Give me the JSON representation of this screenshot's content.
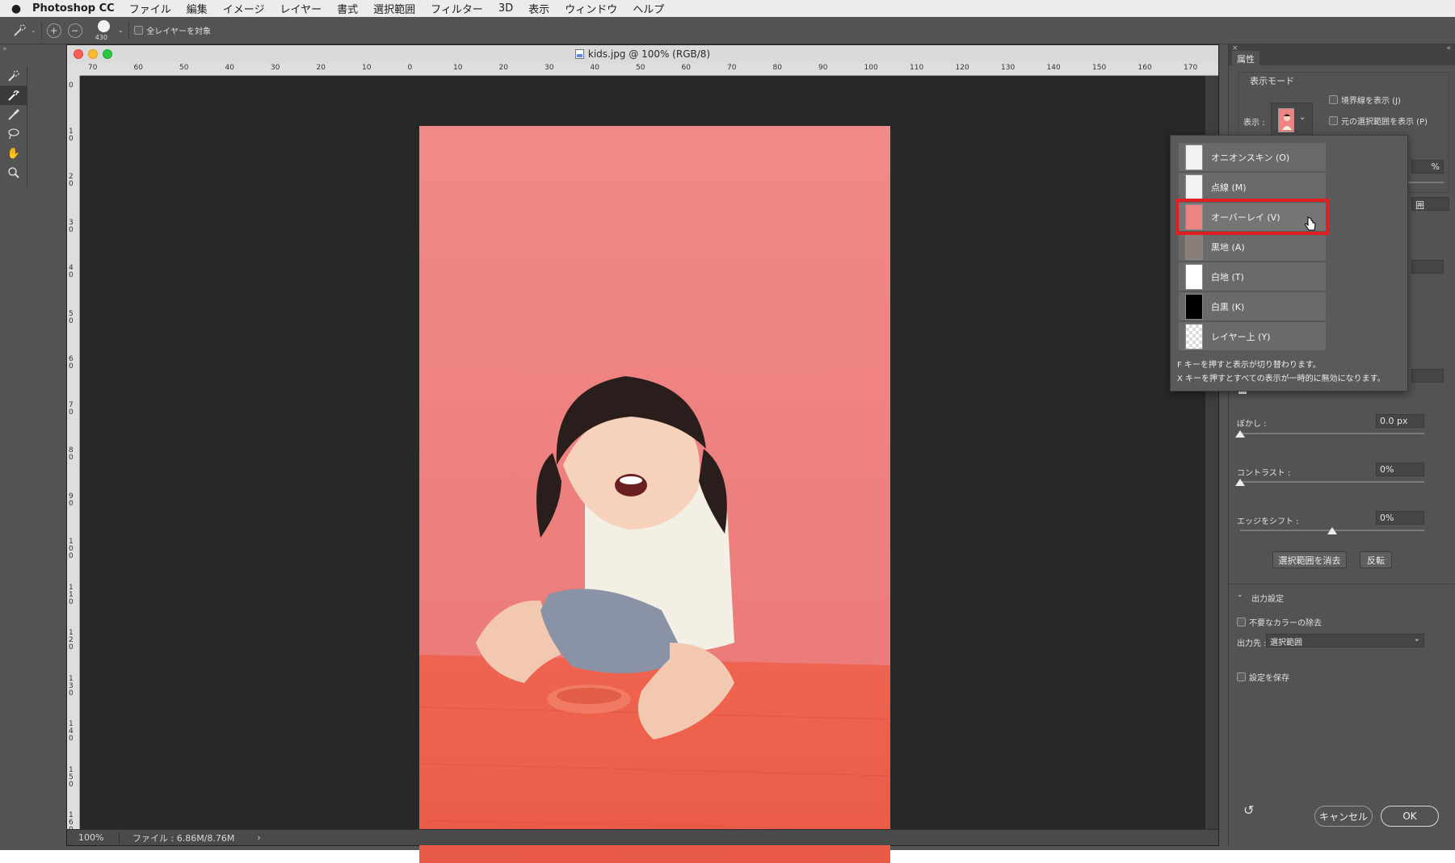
{
  "menubar": {
    "apple": "",
    "app_name": "Photoshop CC",
    "items": [
      "ファイル",
      "編集",
      "イメージ",
      "レイヤー",
      "書式",
      "選択範囲",
      "フィルター",
      "3D",
      "表示",
      "ウィンドウ",
      "ヘルプ"
    ]
  },
  "options_bar": {
    "brush_size": "430",
    "sample_all_layers_label": "全レイヤーを対象"
  },
  "document": {
    "title": "kids.jpg @ 100% (RGB/8)",
    "h_ruler_labels": [
      "70",
      "60",
      "50",
      "40",
      "30",
      "20",
      "10",
      "0",
      "10",
      "20",
      "30",
      "40",
      "50",
      "60",
      "70",
      "80",
      "90",
      "100",
      "110",
      "120",
      "130",
      "140",
      "150",
      "160",
      "170"
    ],
    "v_ruler_labels": [
      "0",
      "1 0",
      "2 0",
      "3 0",
      "4 0",
      "5 0",
      "6 0",
      "7 0",
      "8 0",
      "9 0",
      "1 0 0",
      "1 1 0",
      "1 2 0",
      "1 3 0",
      "1 4 0",
      "1 5 0",
      "1 6 0"
    ],
    "zoom": "100%",
    "file_info": "ファイル : 6.86M/8.76M",
    "status_arrow": "›"
  },
  "panel": {
    "tab_label": "属性",
    "view_mode_heading": "表示モード",
    "view_label": "表示 :",
    "show_edge_label": "境界線を表示 (J)",
    "show_original_label": "元の選択範囲を表示 (P)",
    "partial_percent": "%",
    "partial_select": "囲",
    "feather_label": "ぼかし :",
    "feather_value": "0.0 px",
    "contrast_label": "コントラスト :",
    "contrast_value": "0%",
    "contrast_level": 0,
    "shift_edge_label": "エッジをシフト :",
    "shift_edge_value": "0%",
    "clear_selection_button": "選択範囲を消去",
    "invert_button": "反転",
    "output_heading": "出力設定",
    "decontaminate_label": "不要なカラーの除去",
    "output_to_label": "出力先 :",
    "output_to_value": "選択範囲",
    "remember_settings_label": "設定を保存",
    "cancel_button": "キャンセル",
    "ok_button": "OK"
  },
  "view_dropdown": {
    "items": [
      {
        "label": "オニオンスキン (O)",
        "thumb": "onion"
      },
      {
        "label": "点線 (M)",
        "thumb": "dashed"
      },
      {
        "label": "オーバーレイ (V)",
        "thumb": "overlay"
      },
      {
        "label": "黒地 (A)",
        "thumb": "black"
      },
      {
        "label": "白地 (T)",
        "thumb": "white"
      },
      {
        "label": "白黒 (K)",
        "thumb": "bw"
      },
      {
        "label": "レイヤー上 (Y)",
        "thumb": "layer"
      }
    ],
    "selected_index": 2,
    "note_1": "F キーを押すと表示が切り替わります。",
    "note_2": "X キーを押すとすべての表示が一時的に無効になります。"
  },
  "colors": {
    "overlay_wall": "#ee8482",
    "overlay_floor": "#ec5c4a",
    "highlight_box": "#e02020",
    "ui_gray": "#535353"
  }
}
